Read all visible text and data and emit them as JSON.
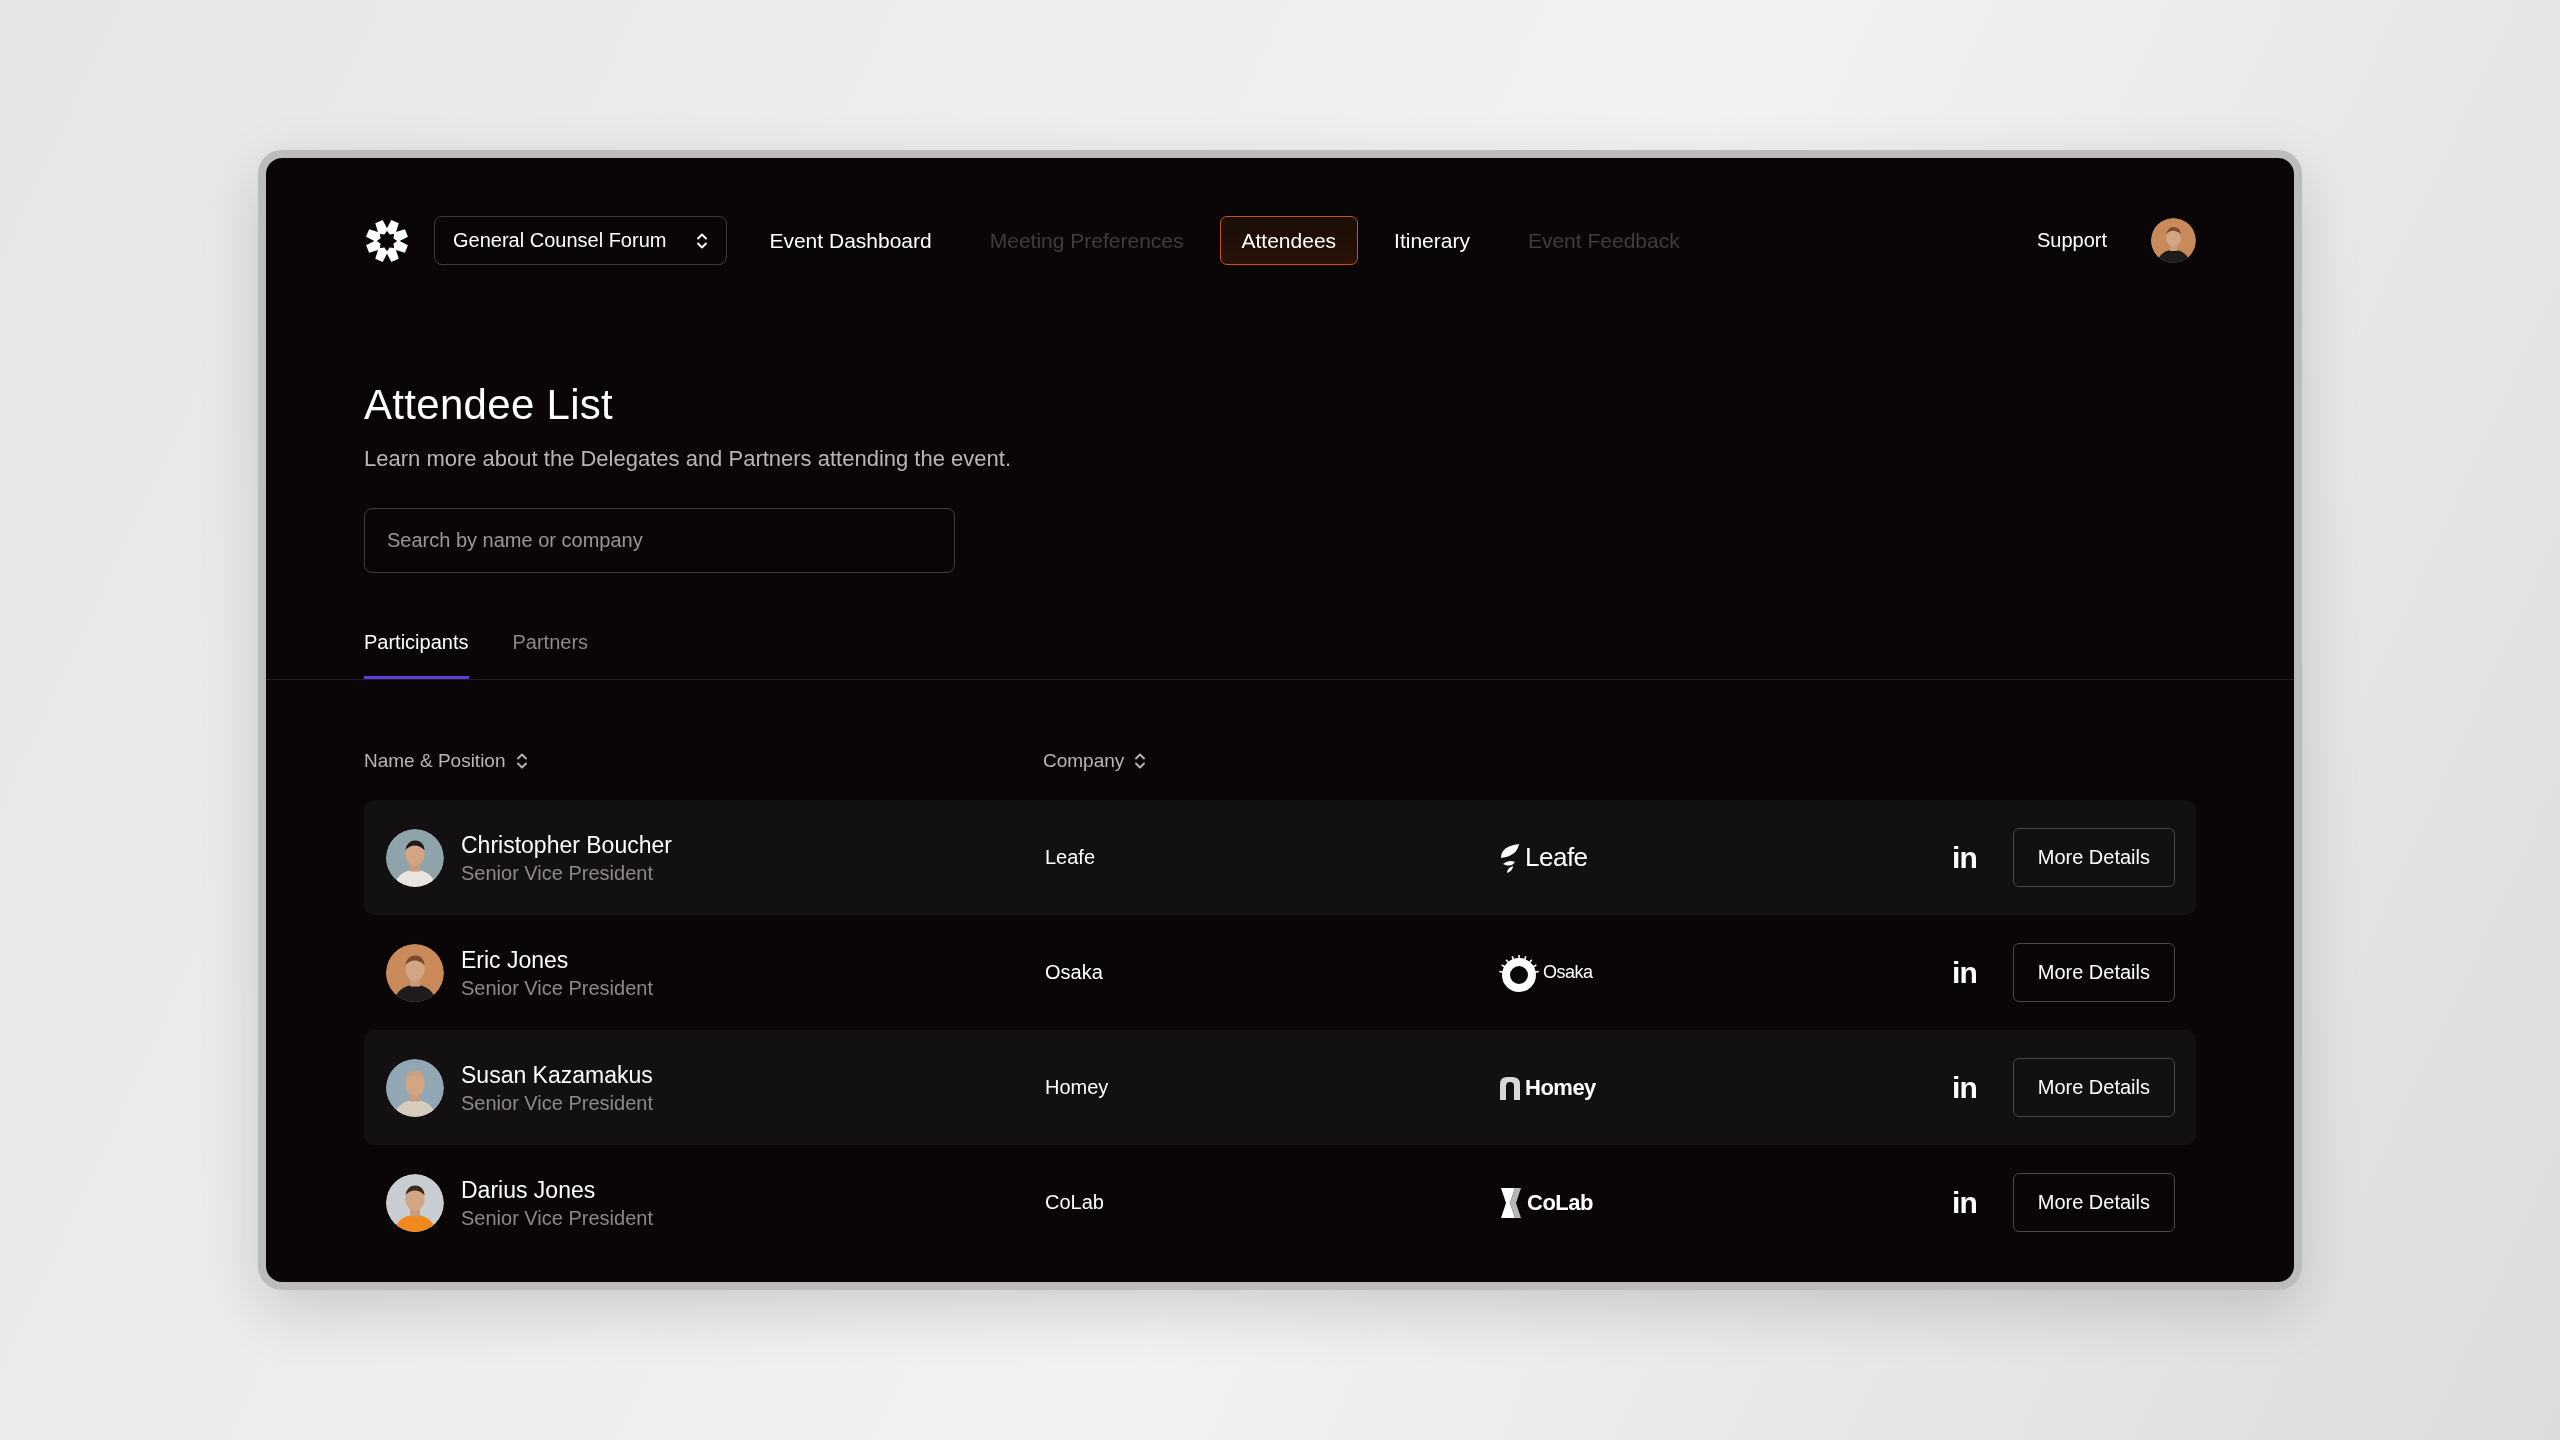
{
  "nav": {
    "event_selector": "General Counsel Forum",
    "items": [
      {
        "label": "Event Dashboard",
        "selected": false,
        "disabled": false
      },
      {
        "label": "Meeting Preferences",
        "selected": false,
        "disabled": true
      },
      {
        "label": "Attendees",
        "selected": true,
        "disabled": false
      },
      {
        "label": "Itinerary",
        "selected": false,
        "disabled": false
      },
      {
        "label": "Event Feedback",
        "selected": false,
        "disabled": true
      }
    ],
    "support": "Support"
  },
  "page": {
    "title": "Attendee List",
    "subtitle": "Learn more about the Delegates and Partners attending the event."
  },
  "search": {
    "placeholder": "Search by name or company"
  },
  "tabs": [
    {
      "label": "Participants",
      "selected": true
    },
    {
      "label": "Partners",
      "selected": false
    }
  ],
  "table": {
    "columns": [
      "Name & Position",
      "Company"
    ],
    "rows": [
      {
        "name": "Christopher Boucher",
        "position": "Senior Vice President",
        "company": "Leafe",
        "logo": {
          "kind": "leaf",
          "text": "Leafe"
        },
        "linkedin": "in",
        "action": "More Details"
      },
      {
        "name": "Eric Jones",
        "position": "Senior Vice President",
        "company": "Osaka",
        "logo": {
          "kind": "ring",
          "text": "Osaka"
        },
        "linkedin": "in",
        "action": "More Details"
      },
      {
        "name": "Susan Kazamakus",
        "position": "Senior Vice President",
        "company": "Homey",
        "logo": {
          "kind": "house",
          "text": "Homey"
        },
        "linkedin": "in",
        "action": "More Details"
      },
      {
        "name": "Darius Jones",
        "position": "Senior Vice President",
        "company": "CoLab",
        "logo": {
          "kind": "hourglass",
          "text": "CoLab"
        },
        "linkedin": "in",
        "action": "More Details"
      }
    ]
  }
}
